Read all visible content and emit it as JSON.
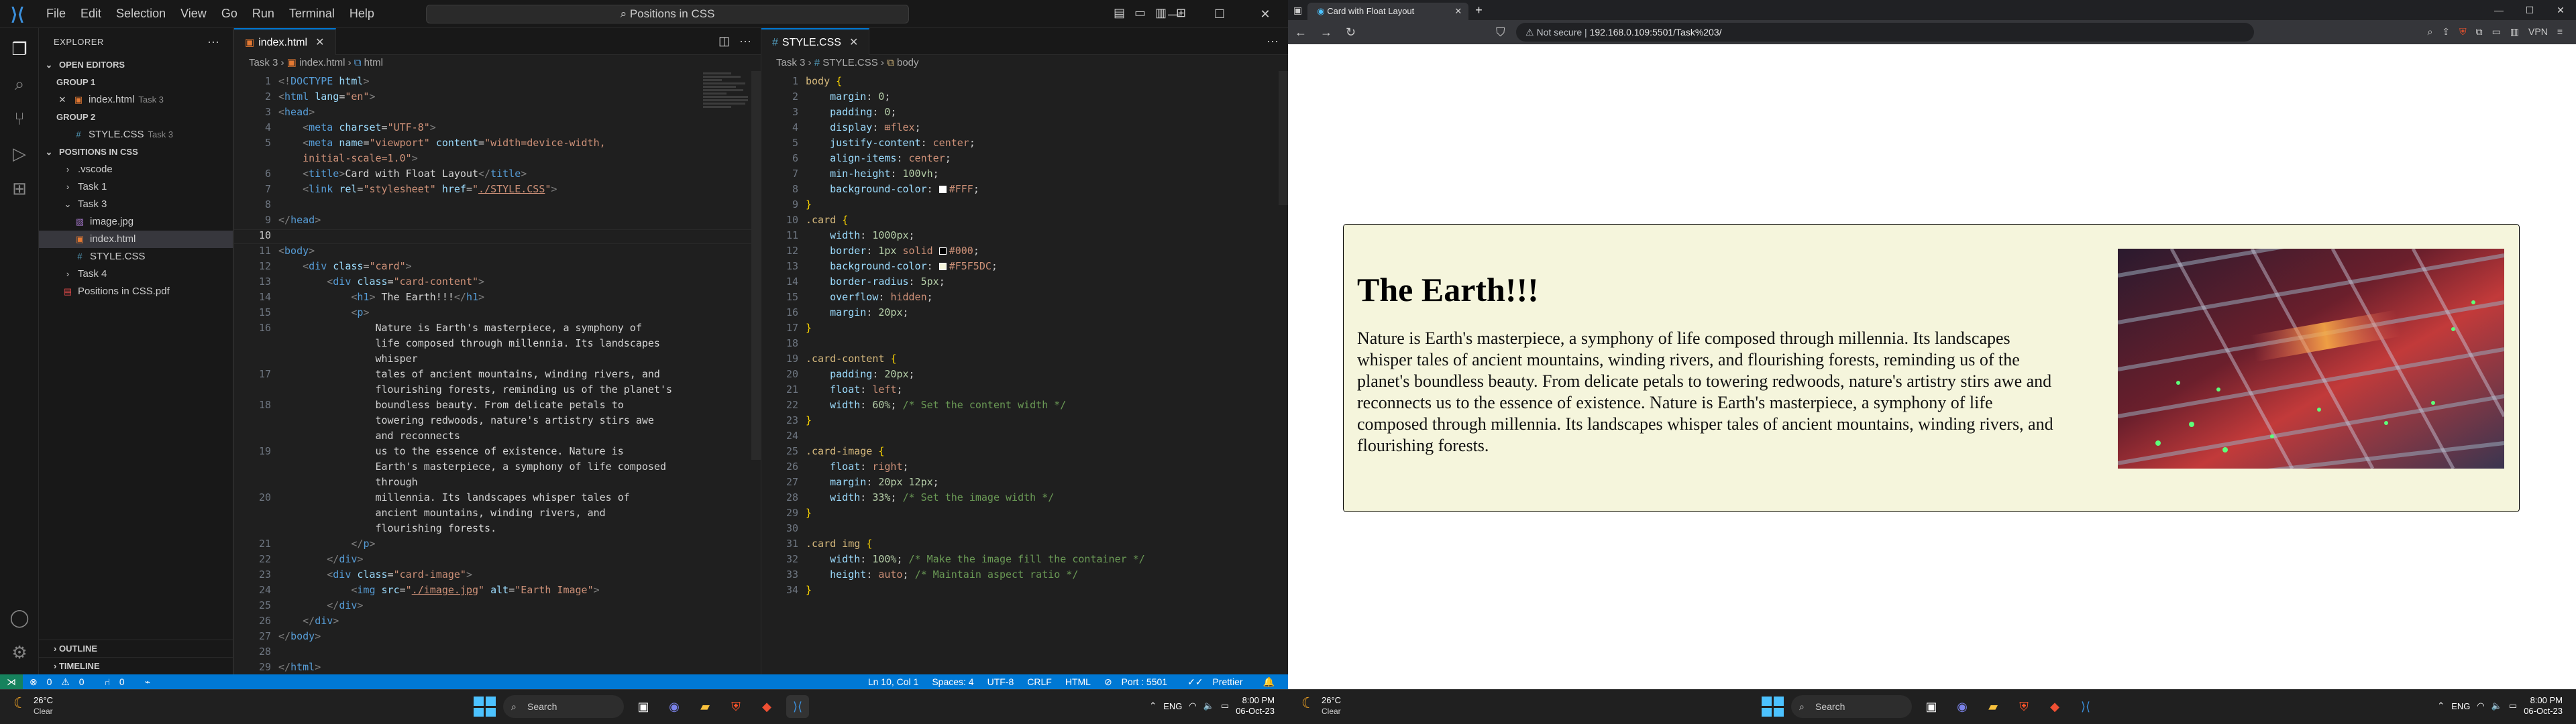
{
  "vscode": {
    "menu": [
      "File",
      "Edit",
      "Selection",
      "View",
      "Go",
      "Run",
      "Terminal",
      "Help"
    ],
    "command_center": "Positions in CSS",
    "window_controls": [
      "—",
      "☐",
      "✕"
    ],
    "explorer": {
      "title": "EXPLORER",
      "open_editors": "OPEN EDITORS",
      "group1": "GROUP 1",
      "group1_file": "index.html",
      "group1_file_path": "Task 3",
      "group2": "GROUP 2",
      "group2_file": "STYLE.CSS",
      "group2_file_path": "Task 3",
      "workspace": "POSITIONS IN CSS",
      "tree": [
        {
          "label": ".vscode",
          "type": "folder",
          "indent": 1,
          "open": false
        },
        {
          "label": "Task 1",
          "type": "folder",
          "indent": 1,
          "open": false
        },
        {
          "label": "Task 3",
          "type": "folder",
          "indent": 1,
          "open": true
        },
        {
          "label": "image.jpg",
          "type": "image",
          "indent": 2
        },
        {
          "label": "index.html",
          "type": "html",
          "indent": 2,
          "selected": true
        },
        {
          "label": "STYLE.CSS",
          "type": "css",
          "indent": 2
        },
        {
          "label": "Task 4",
          "type": "folder",
          "indent": 1,
          "open": false
        },
        {
          "label": "Positions in CSS.pdf",
          "type": "pdf",
          "indent": 1
        }
      ],
      "outline": "OUTLINE",
      "timeline": "TIMELINE"
    },
    "left_editor": {
      "tab": "index.html",
      "breadcrumb": [
        "Task 3",
        "index.html",
        "html"
      ],
      "lines": [
        {
          "n": "1",
          "h": "<span class=\"t-pu\">&lt;!</span><span class=\"t-tag\">DOCTYPE</span> <span class=\"t-at\">html</span><span class=\"t-pu\">&gt;</span>"
        },
        {
          "n": "2",
          "h": "<span class=\"t-pu\">&lt;</span><span class=\"t-tag\">html</span> <span class=\"t-at\">lang</span>=<span class=\"t-str\">\"en\"</span><span class=\"t-pu\">&gt;</span>"
        },
        {
          "n": "3",
          "h": "<span class=\"t-pu\">&lt;</span><span class=\"t-tag\">head</span><span class=\"t-pu\">&gt;</span>"
        },
        {
          "n": "4",
          "h": "    <span class=\"t-pu\">&lt;</span><span class=\"t-tag\">meta</span> <span class=\"t-at\">charset</span>=<span class=\"t-str\">\"UTF-8\"</span><span class=\"t-pu\">&gt;</span>"
        },
        {
          "n": "5",
          "h": "    <span class=\"t-pu\">&lt;</span><span class=\"t-tag\">meta</span> <span class=\"t-at\">name</span>=<span class=\"t-str\">\"viewport\"</span> <span class=\"t-at\">content</span>=<span class=\"t-str\">\"width=device-width,</span>"
        },
        {
          "n": "",
          "h": "    <span class=\"t-str\">initial-scale=1.0\"</span><span class=\"t-pu\">&gt;</span>"
        },
        {
          "n": "6",
          "h": "    <span class=\"t-pu\">&lt;</span><span class=\"t-tag\">title</span><span class=\"t-pu\">&gt;</span><span class=\"t-tx\">Card with Float Layout</span><span class=\"t-pu\">&lt;/</span><span class=\"t-tag\">title</span><span class=\"t-pu\">&gt;</span>"
        },
        {
          "n": "7",
          "h": "    <span class=\"t-pu\">&lt;</span><span class=\"t-tag\">link</span> <span class=\"t-at\">rel</span>=<span class=\"t-str\">\"stylesheet\"</span> <span class=\"t-at\">href</span>=<span class=\"t-str\">\"<u>./STYLE.CSS</u>\"</span><span class=\"t-pu\">&gt;</span>"
        },
        {
          "n": "8",
          "h": ""
        },
        {
          "n": "9",
          "h": "<span class=\"t-pu\">&lt;/</span><span class=\"t-tag\">head</span><span class=\"t-pu\">&gt;</span>"
        },
        {
          "n": "10",
          "h": "",
          "cur": true
        },
        {
          "n": "11",
          "h": "<span class=\"t-pu\">&lt;</span><span class=\"t-tag\">body</span><span class=\"t-pu\">&gt;</span>"
        },
        {
          "n": "12",
          "h": "    <span class=\"t-pu\">&lt;</span><span class=\"t-tag\">div</span> <span class=\"t-at\">class</span>=<span class=\"t-str\">\"card\"</span><span class=\"t-pu\">&gt;</span>"
        },
        {
          "n": "13",
          "h": "        <span class=\"t-pu\">&lt;</span><span class=\"t-tag\">div</span> <span class=\"t-at\">class</span>=<span class=\"t-str\">\"card-content\"</span><span class=\"t-pu\">&gt;</span>"
        },
        {
          "n": "14",
          "h": "            <span class=\"t-pu\">&lt;</span><span class=\"t-tag\">h1</span><span class=\"t-pu\">&gt;</span> <span class=\"t-tx\">The Earth!!!</span><span class=\"t-pu\">&lt;/</span><span class=\"t-tag\">h1</span><span class=\"t-pu\">&gt;</span>"
        },
        {
          "n": "15",
          "h": "            <span class=\"t-pu\">&lt;</span><span class=\"t-tag\">p</span><span class=\"t-pu\">&gt;</span>"
        },
        {
          "n": "16",
          "h": "                <span class=\"t-tx\">Nature is Earth's masterpiece, a symphony of</span>"
        },
        {
          "n": "",
          "h": "                <span class=\"t-tx\">life composed through millennia. Its landscapes</span>"
        },
        {
          "n": "",
          "h": "                <span class=\"t-tx\">whisper</span>"
        },
        {
          "n": "17",
          "h": "                <span class=\"t-tx\">tales of ancient mountains, winding rivers, and</span>"
        },
        {
          "n": "",
          "h": "                <span class=\"t-tx\">flourishing forests, reminding us of the planet's</span>"
        },
        {
          "n": "18",
          "h": "                <span class=\"t-tx\">boundless beauty. From delicate petals to</span>"
        },
        {
          "n": "",
          "h": "                <span class=\"t-tx\">towering redwoods, nature's artistry stirs awe</span>"
        },
        {
          "n": "",
          "h": "                <span class=\"t-tx\">and reconnects</span>"
        },
        {
          "n": "19",
          "h": "                <span class=\"t-tx\">us to the essence of existence. Nature is</span>"
        },
        {
          "n": "",
          "h": "                <span class=\"t-tx\">Earth's masterpiece, a symphony of life composed</span>"
        },
        {
          "n": "",
          "h": "                <span class=\"t-tx\">through</span>"
        },
        {
          "n": "20",
          "h": "                <span class=\"t-tx\">millennia. Its landscapes whisper tales of</span>"
        },
        {
          "n": "",
          "h": "                <span class=\"t-tx\">ancient mountains, winding rivers, and</span>"
        },
        {
          "n": "",
          "h": "                <span class=\"t-tx\">flourishing forests.</span>"
        },
        {
          "n": "21",
          "h": "            <span class=\"t-pu\">&lt;/</span><span class=\"t-tag\">p</span><span class=\"t-pu\">&gt;</span>"
        },
        {
          "n": "22",
          "h": "        <span class=\"t-pu\">&lt;/</span><span class=\"t-tag\">div</span><span class=\"t-pu\">&gt;</span>"
        },
        {
          "n": "23",
          "h": "        <span class=\"t-pu\">&lt;</span><span class=\"t-tag\">div</span> <span class=\"t-at\">class</span>=<span class=\"t-str\">\"card-image\"</span><span class=\"t-pu\">&gt;</span>"
        },
        {
          "n": "24",
          "h": "            <span class=\"t-pu\">&lt;</span><span class=\"t-tag\">img</span> <span class=\"t-at\">src</span>=<span class=\"t-str\">\"<u>./image.jpg</u>\"</span> <span class=\"t-at\">alt</span>=<span class=\"t-str\">\"Earth Image\"</span><span class=\"t-pu\">&gt;</span>"
        },
        {
          "n": "25",
          "h": "        <span class=\"t-pu\">&lt;/</span><span class=\"t-tag\">div</span><span class=\"t-pu\">&gt;</span>"
        },
        {
          "n": "26",
          "h": "    <span class=\"t-pu\">&lt;/</span><span class=\"t-tag\">div</span><span class=\"t-pu\">&gt;</span>"
        },
        {
          "n": "27",
          "h": "<span class=\"t-pu\">&lt;/</span><span class=\"t-tag\">body</span><span class=\"t-pu\">&gt;</span>"
        },
        {
          "n": "28",
          "h": ""
        },
        {
          "n": "29",
          "h": "<span class=\"t-pu\">&lt;/</span><span class=\"t-tag\">html</span><span class=\"t-pu\">&gt;</span>"
        }
      ]
    },
    "right_editor": {
      "tab": "STYLE.CSS",
      "breadcrumb": [
        "Task 3",
        "STYLE.CSS",
        "body"
      ],
      "lines": [
        {
          "n": "1",
          "h": "<span class=\"t-sel\">body</span> <span class=\"t-br\">{</span>"
        },
        {
          "n": "2",
          "h": "    <span class=\"t-pr\">margin</span>: <span class=\"t-nu\">0</span>;"
        },
        {
          "n": "3",
          "h": "    <span class=\"t-pr\">padding</span>: <span class=\"t-nu\">0</span>;"
        },
        {
          "n": "4",
          "h": "    <span class=\"t-pr\">display</span>: <span class=\"t-kw\">⊞flex</span>;"
        },
        {
          "n": "5",
          "h": "    <span class=\"t-pr\">justify-content</span>: <span class=\"t-kw\">center</span>;"
        },
        {
          "n": "6",
          "h": "    <span class=\"t-pr\">align-items</span>: <span class=\"t-kw\">center</span>;"
        },
        {
          "n": "7",
          "h": "    <span class=\"t-pr\">min-height</span>: <span class=\"t-nu\">100vh</span>;"
        },
        {
          "n": "8",
          "h": "    <span class=\"t-pr\">background-color</span>: <span class=\"swatch\" style=\"background:#fff\"></span><span class=\"t-kw\">#FFF</span>;"
        },
        {
          "n": "9",
          "h": "<span class=\"t-br\">}</span>"
        },
        {
          "n": "10",
          "h": "<span class=\"t-sel\">.card</span> <span class=\"t-br\">{</span>"
        },
        {
          "n": "11",
          "h": "    <span class=\"t-pr\">width</span>: <span class=\"t-nu\">1000px</span>;"
        },
        {
          "n": "12",
          "h": "    <span class=\"t-pr\">border</span>: <span class=\"t-nu\">1px</span> <span class=\"t-kw\">solid</span> <span class=\"swatch\" style=\"background:#000\"></span><span class=\"t-kw\">#000</span>;"
        },
        {
          "n": "13",
          "h": "    <span class=\"t-pr\">background-color</span>: <span class=\"swatch\" style=\"background:#f5f5dc\"></span><span class=\"t-kw\">#F5F5DC</span>;"
        },
        {
          "n": "14",
          "h": "    <span class=\"t-pr\">border-radius</span>: <span class=\"t-nu\">5px</span>;"
        },
        {
          "n": "15",
          "h": "    <span class=\"t-pr\">overflow</span>: <span class=\"t-kw\">hidden</span>;"
        },
        {
          "n": "16",
          "h": "    <span class=\"t-pr\">margin</span>: <span class=\"t-nu\">20px</span>;"
        },
        {
          "n": "17",
          "h": "<span class=\"t-br\">}</span>"
        },
        {
          "n": "18",
          "h": ""
        },
        {
          "n": "19",
          "h": "<span class=\"t-sel\">.card-content</span> <span class=\"t-br\">{</span>"
        },
        {
          "n": "20",
          "h": "    <span class=\"t-pr\">padding</span>: <span class=\"t-nu\">20px</span>;"
        },
        {
          "n": "21",
          "h": "    <span class=\"t-pr\">float</span>: <span class=\"t-kw\">left</span>;"
        },
        {
          "n": "22",
          "h": "    <span class=\"t-pr\">width</span>: <span class=\"t-nu\">60%</span>; <span class=\"t-co\">/* Set the content width */</span>"
        },
        {
          "n": "23",
          "h": "<span class=\"t-br\">}</span>"
        },
        {
          "n": "24",
          "h": ""
        },
        {
          "n": "25",
          "h": "<span class=\"t-sel\">.card-image</span> <span class=\"t-br\">{</span>"
        },
        {
          "n": "26",
          "h": "    <span class=\"t-pr\">float</span>: <span class=\"t-kw\">right</span>;"
        },
        {
          "n": "27",
          "h": "    <span class=\"t-pr\">margin</span>: <span class=\"t-nu\">20px 12px</span>;"
        },
        {
          "n": "28",
          "h": "    <span class=\"t-pr\">width</span>: <span class=\"t-nu\">33%</span>; <span class=\"t-co\">/* Set the image width */</span>"
        },
        {
          "n": "29",
          "h": "<span class=\"t-br\">}</span>"
        },
        {
          "n": "30",
          "h": ""
        },
        {
          "n": "31",
          "h": "<span class=\"t-sel\">.card img</span> <span class=\"t-br\">{</span>"
        },
        {
          "n": "32",
          "h": "    <span class=\"t-pr\">width</span>: <span class=\"t-nu\">100%</span>; <span class=\"t-co\">/* Make the image fill the container */</span>"
        },
        {
          "n": "33",
          "h": "    <span class=\"t-pr\">height</span>: <span class=\"t-kw\">auto</span>; <span class=\"t-co\">/* Maintain aspect ratio */</span>"
        },
        {
          "n": "34",
          "h": "<span class=\"t-br\">}</span>"
        }
      ]
    },
    "status": {
      "errors": "0",
      "warnings": "0",
      "ports": "0",
      "position": "Ln 10, Col 1",
      "spaces": "Spaces: 4",
      "encoding": "UTF-8",
      "eol": "CRLF",
      "language": "HTML",
      "port": "Port : 5501",
      "prettier": "Prettier"
    }
  },
  "browser": {
    "tab_title": "Card with Float Layout",
    "not_secure": "Not secure",
    "url": "192.168.0.109:5501/Task%203/",
    "vpn": "VPN",
    "card": {
      "heading": "The Earth!!!",
      "paragraph": "Nature is Earth's masterpiece, a symphony of life composed through millennia. Its landscapes whisper tales of ancient mountains, winding rivers, and flourishing forests, reminding us of the planet's boundless beauty. From delicate petals to towering redwoods, nature's artistry stirs awe and reconnects us to the essence of existence. Nature is Earth's masterpiece, a symphony of life composed through millennia. Its landscapes whisper tales of ancient mountains, winding rivers, and flourishing forests.",
      "image_alt": "Earth Image"
    }
  },
  "taskbar": {
    "temperature": "26°C",
    "condition": "Clear",
    "search": "Search",
    "lang": "ENG",
    "time": "8:00 PM",
    "date": "06-Oct-23"
  }
}
